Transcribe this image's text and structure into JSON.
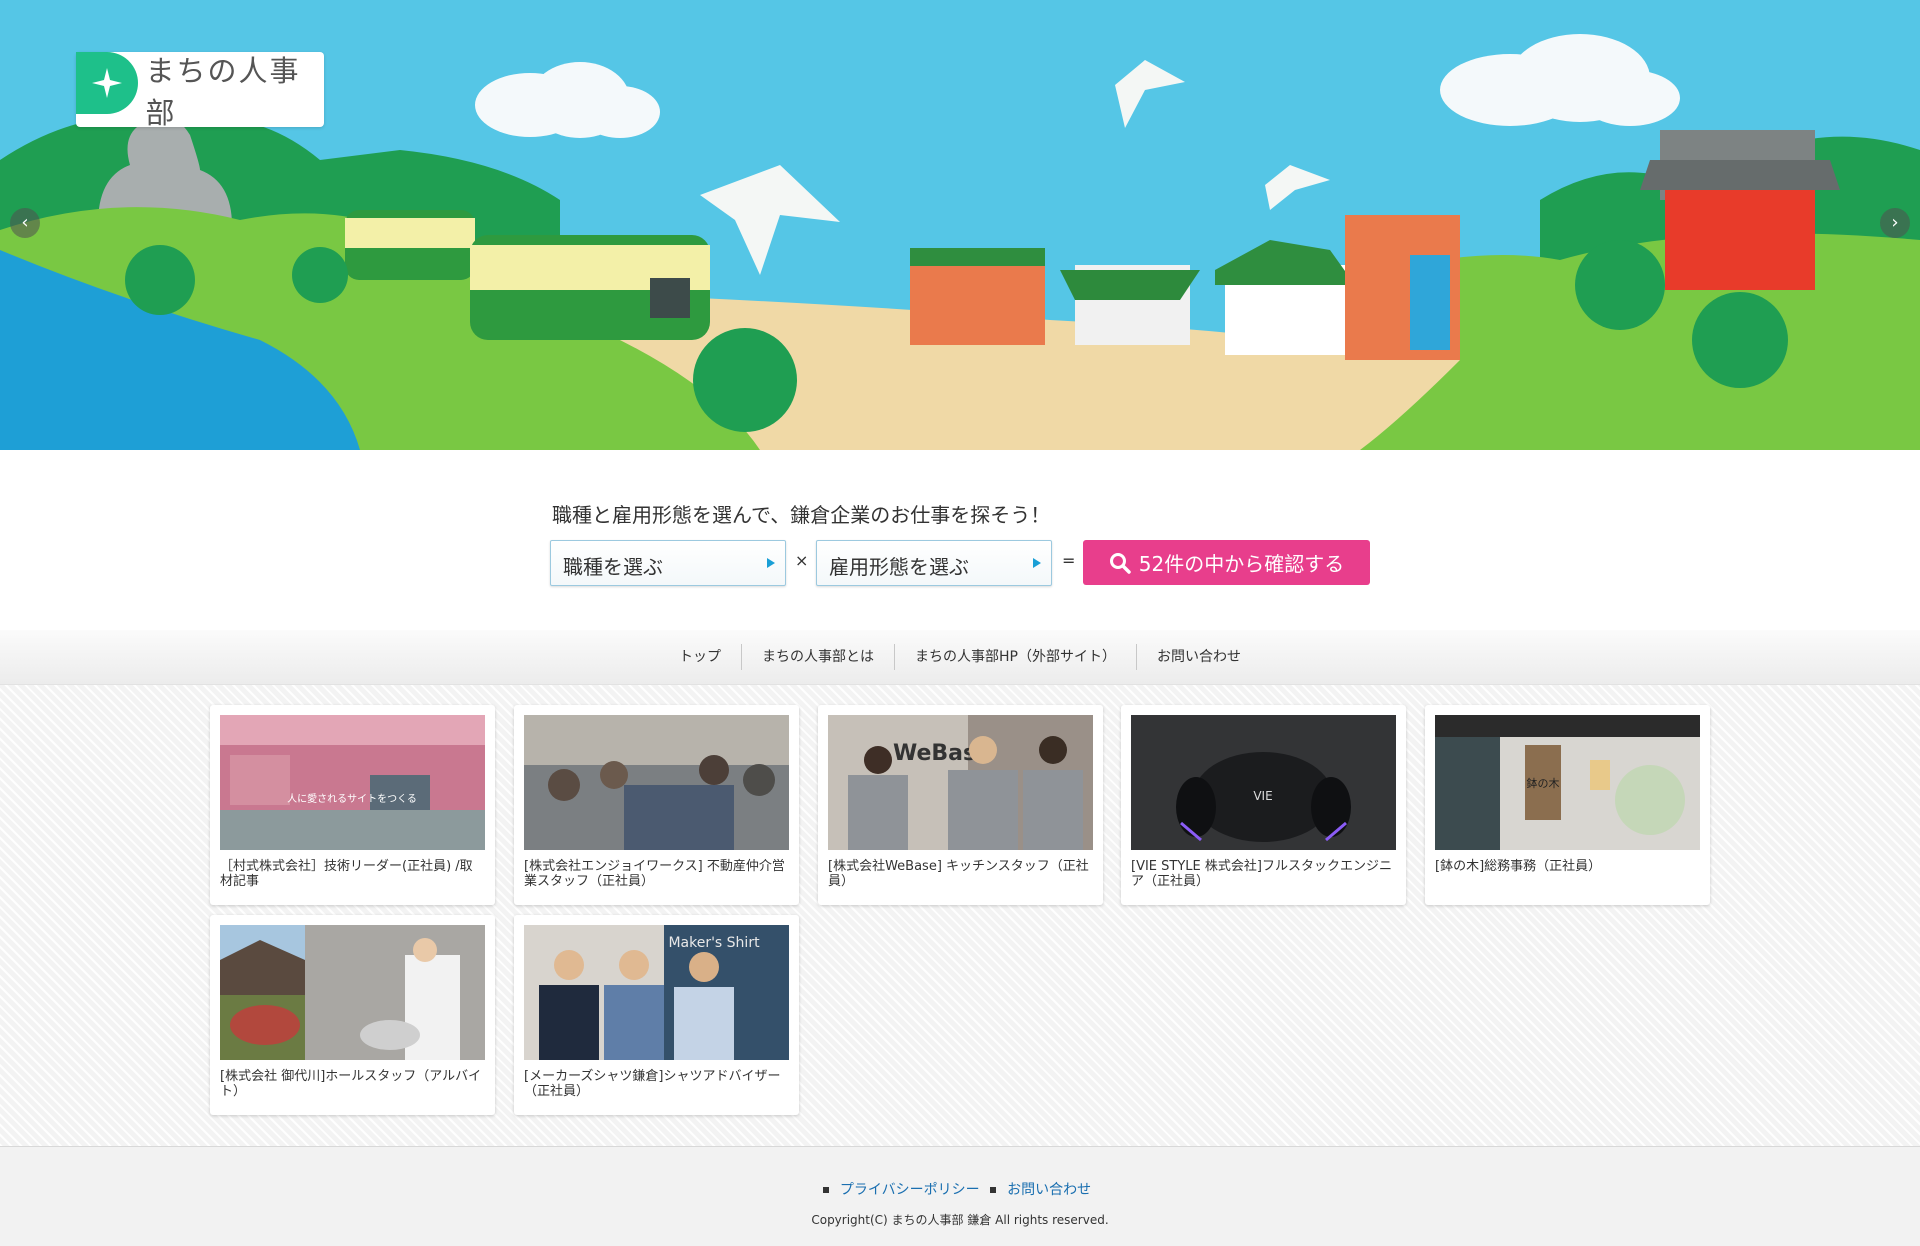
{
  "brand": {
    "name": "まちの人事部",
    "accent": "#1ec08a"
  },
  "hero": {
    "prev_icon": "chevron-left-icon",
    "next_icon": "chevron-right-icon"
  },
  "search": {
    "lead": "職種と雇用形態を選んで、鎌倉企業のお仕事を探そう！",
    "job_select": "職種を選ぶ",
    "type_select": "雇用形態を選ぶ",
    "times": "×",
    "equals": "=",
    "button": "52件の中から確認する",
    "button_color": "#e83e8c"
  },
  "nav": {
    "items": [
      "トップ",
      "まちの人事部とは",
      "まちの人事部HP（外部サイト）",
      "お問い合わせ"
    ]
  },
  "cards": [
    {
      "title": "［村式株式会社］技術リーダー(正社員) /取材記事",
      "overlay": "人に愛されるサイトをつくる"
    },
    {
      "title": "[株式会社エンジョイワークス] 不動産仲介営業スタッフ（正社員）"
    },
    {
      "title": "[株式会社WeBase] キッチンスタッフ（正社員）",
      "overlay": "WeBase"
    },
    {
      "title": "[VIE STYLE 株式会社]フルスタックエンジニア（正社員）",
      "overlay": "VIE"
    },
    {
      "title": "[鉢の木]総務事務（正社員）",
      "overlay": "鉢の木"
    },
    {
      "title": "[株式会社 御代川]ホールスタッフ（アルバイト）"
    },
    {
      "title": "[メーカーズシャツ鎌倉]シャツアドバイザー（正社員）",
      "overlay": "Maker's Shirt"
    }
  ],
  "footer": {
    "links": [
      "プライバシーポリシー",
      "お問い合わせ"
    ],
    "copyright": "Copyright(C) まちの人事部 鎌倉 All rights reserved."
  }
}
